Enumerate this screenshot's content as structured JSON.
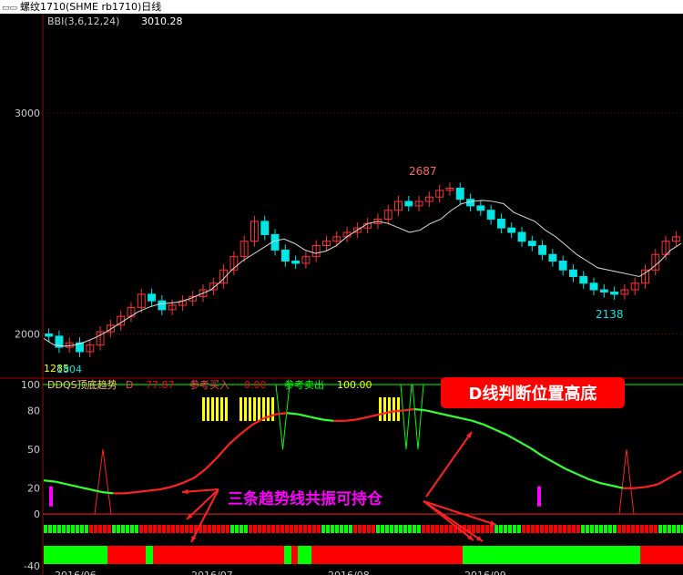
{
  "window": {
    "icon": "window-icon",
    "title": "螺纹1710(SHME rb1710)日线"
  },
  "chart_data": [
    {
      "type": "candlestick",
      "indicator_label": "BBI(3,6,12,24)",
      "indicator_value": "3010.28",
      "y_ticks": [
        3000,
        2000
      ],
      "ylim": [
        1800,
        3450
      ],
      "annotations": {
        "high": "2687",
        "low": "2138",
        "left": "1804",
        "left_overlap": "1285"
      },
      "x_ticks": [
        "2016/06",
        "2016/07",
        "2016/08",
        "2016/09"
      ],
      "series": [
        {
          "name": "BBI",
          "values": [
            1980,
            1950,
            1945,
            1950,
            1965,
            1985,
            2010,
            2040,
            2070,
            2100,
            2120,
            2135,
            2140,
            2145,
            2160,
            2180,
            2200,
            2240,
            2290,
            2330,
            2360,
            2390,
            2420,
            2430,
            2410,
            2380,
            2365,
            2375,
            2400,
            2440,
            2470,
            2500,
            2510,
            2500,
            2480,
            2460,
            2470,
            2500,
            2520,
            2560,
            2590,
            2600,
            2605,
            2600,
            2590,
            2550,
            2530,
            2510,
            2470,
            2440,
            2400,
            2360,
            2330,
            2300,
            2290,
            2280,
            2270,
            2260,
            2290,
            2330,
            2380,
            2410
          ]
        }
      ],
      "closes": [
        1990,
        1940,
        1960,
        1920,
        1950,
        2010,
        2040,
        2080,
        2120,
        2180,
        2150,
        2110,
        2130,
        2150,
        2170,
        2200,
        2230,
        2290,
        2350,
        2420,
        2510,
        2450,
        2380,
        2330,
        2320,
        2350,
        2400,
        2420,
        2440,
        2460,
        2480,
        2500,
        2520,
        2560,
        2600,
        2580,
        2600,
        2620,
        2650,
        2660,
        2610,
        2580,
        2560,
        2520,
        2480,
        2460,
        2420,
        2400,
        2360,
        2330,
        2290,
        2260,
        2230,
        2200,
        2190,
        2180,
        2200,
        2230,
        2290,
        2360,
        2420,
        2440
      ]
    },
    {
      "type": "line",
      "title": "DDQS顶底趋势",
      "series": [
        {
          "name": "D",
          "value": "77.87",
          "color": "#ff0000"
        },
        {
          "name": "参考买入",
          "value": "0.00",
          "color": "#ff0000"
        },
        {
          "name": "参考卖出",
          "value": "100.00",
          "color": "#ffff00"
        }
      ],
      "y_ticks": [
        100,
        80,
        50,
        20,
        0,
        -40
      ],
      "ylim": [
        -40,
        100
      ],
      "d_line": [
        26,
        25,
        23,
        21,
        19,
        17,
        16,
        16,
        17,
        18,
        19,
        21,
        24,
        28,
        35,
        44,
        54,
        62,
        69,
        74,
        77,
        78,
        77,
        75,
        73,
        72,
        72,
        73,
        75,
        77,
        79,
        80,
        81,
        80,
        78,
        76,
        74,
        72,
        69,
        65,
        61,
        56,
        51,
        45,
        40,
        35,
        31,
        27,
        24,
        22,
        20,
        20,
        21,
        23,
        28,
        33
      ],
      "annotations": [
        "D线判断位置高底",
        "三条趋势线共振可持仓"
      ],
      "colors": {
        "up": "#ff0000",
        "down": "#00ff00",
        "sell": "#ffff00",
        "buy_marker": "#ff00ff",
        "callout_bg": "#ff0000",
        "callout_text": "#ffffff",
        "text_magenta": "#ff00ff"
      }
    }
  ]
}
